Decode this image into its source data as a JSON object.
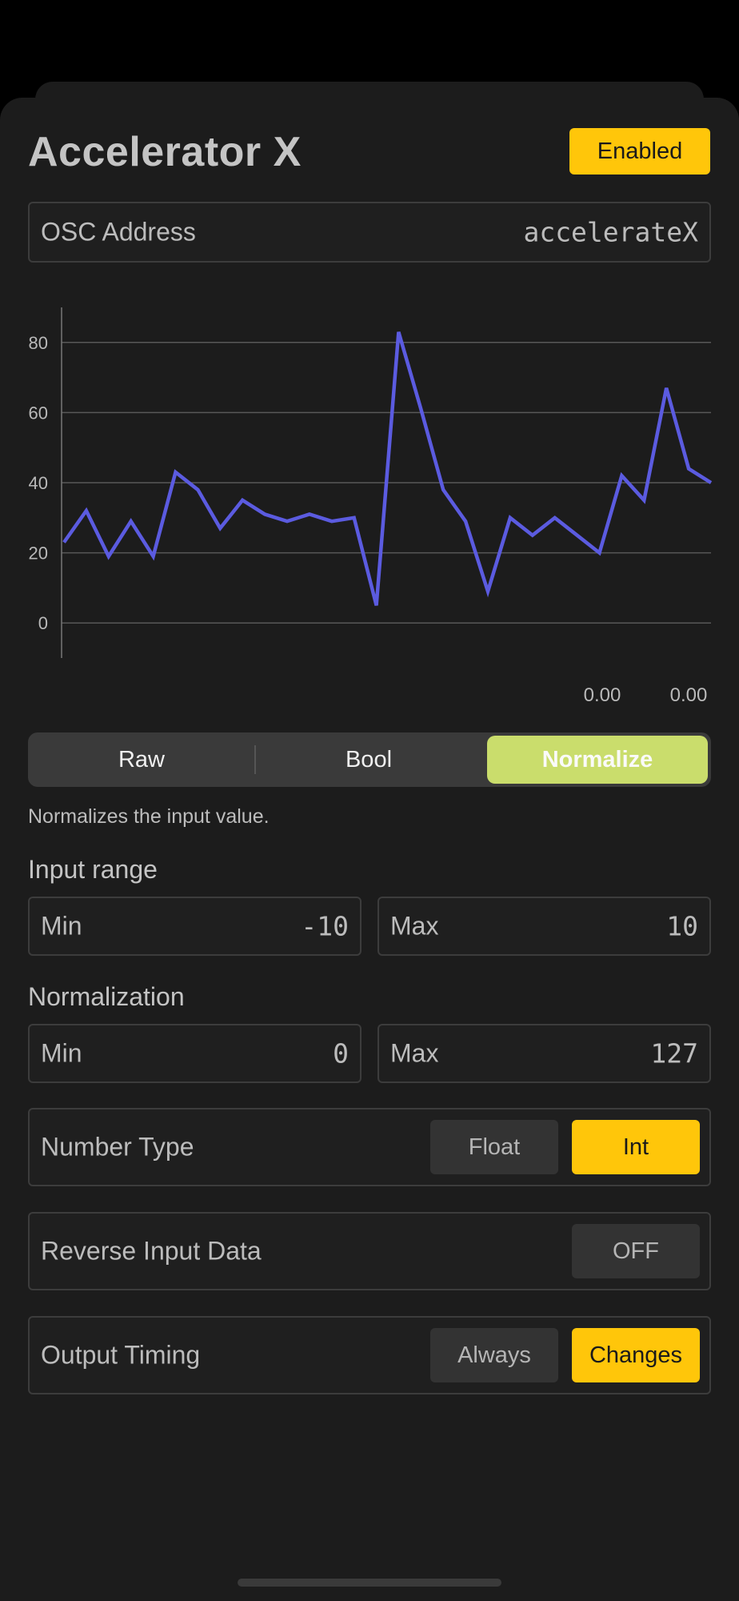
{
  "header": {
    "title": "Accelerator X",
    "enabled_label": "Enabled"
  },
  "osc": {
    "label": "OSC Address",
    "value": "accelerateX"
  },
  "chart_data": {
    "type": "line",
    "y_ticks": [
      "80",
      "60",
      "40",
      "20",
      "0"
    ],
    "ylim": [
      -10,
      90
    ],
    "readouts": [
      "0.00",
      "0.00"
    ],
    "series": [
      {
        "color": "#5b5be0",
        "values": [
          23,
          32,
          19,
          29,
          19,
          43,
          38,
          27,
          35,
          31,
          29,
          31,
          29,
          30,
          5,
          83,
          61,
          38,
          29,
          9,
          30,
          25,
          30,
          25,
          20,
          42,
          35,
          67,
          44,
          40
        ]
      }
    ]
  },
  "mode": {
    "options": [
      "Raw",
      "Bool",
      "Normalize"
    ],
    "selected": "Normalize",
    "description": "Normalizes the input value."
  },
  "input_range": {
    "title": "Input range",
    "min_label": "Min",
    "min_value": "-10",
    "max_label": "Max",
    "max_value": "10"
  },
  "normalization": {
    "title": "Normalization",
    "min_label": "Min",
    "min_value": "0",
    "max_label": "Max",
    "max_value": "127"
  },
  "number_type": {
    "label": "Number Type",
    "options": [
      "Float",
      "Int"
    ],
    "selected": "Int"
  },
  "reverse": {
    "label": "Reverse Input Data",
    "value": "OFF"
  },
  "output_timing": {
    "label": "Output Timing",
    "options": [
      "Always",
      "Changes"
    ],
    "selected": "Changes"
  },
  "colors": {
    "accent_yellow": "#ffc60a",
    "segment_selected": "#cadd6c",
    "line": "#5b5be0",
    "background": "#1c1c1c"
  }
}
